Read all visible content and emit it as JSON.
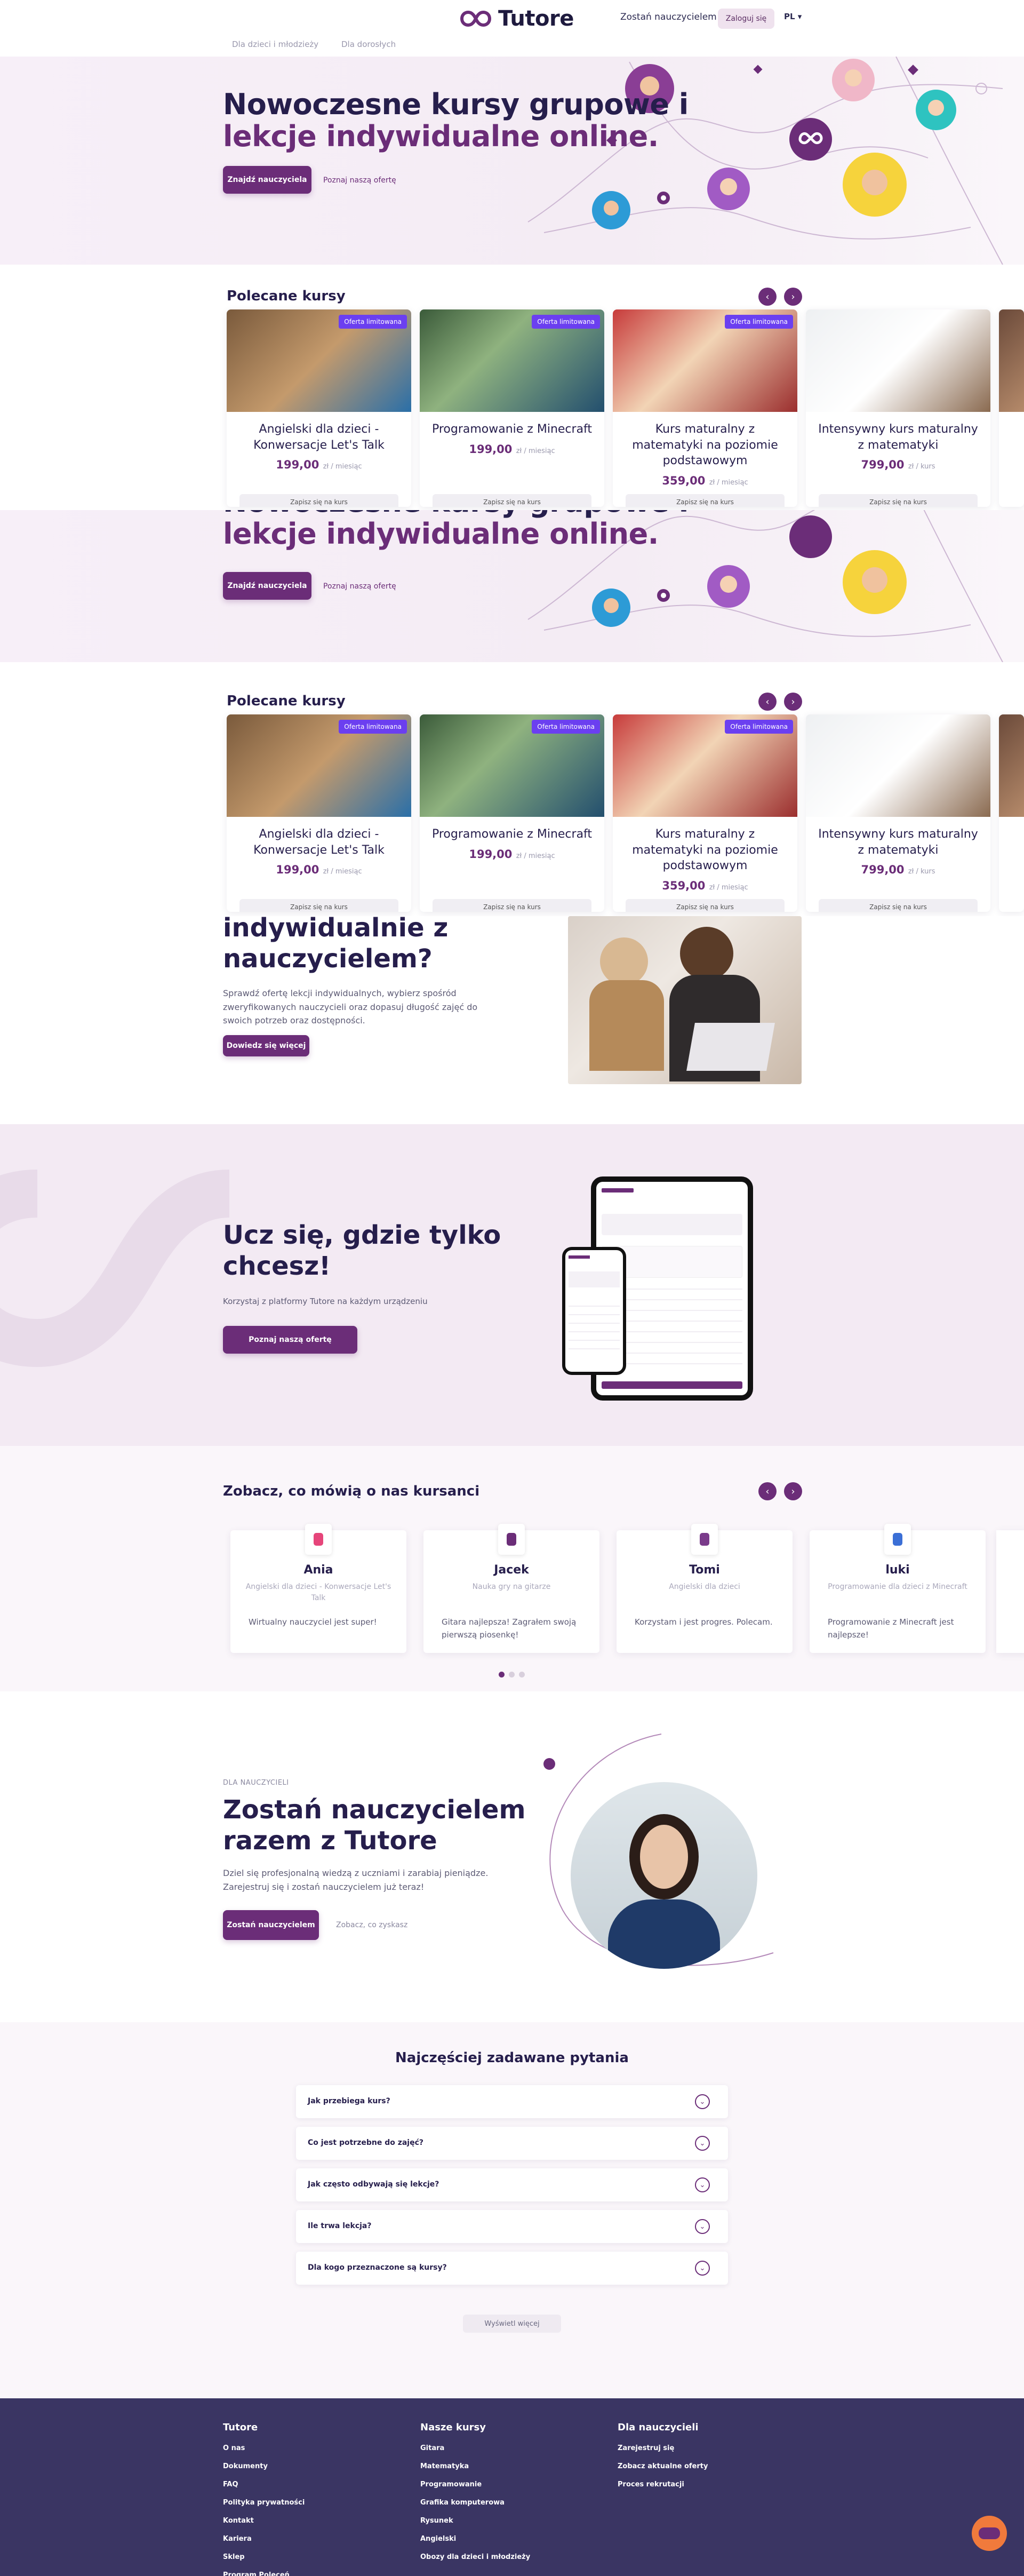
{
  "header": {
    "logo": "Tutore",
    "become_teacher": "Zostań nauczycielem",
    "login": "Zaloguj się",
    "lang": "PL",
    "subnav": [
      "Dla dzieci i młodzieży",
      "Dla dorosłych"
    ]
  },
  "hero": {
    "title_line1": "Nowoczesne kursy grupowe i",
    "title_line2": "lekcje indywidualne online.",
    "btn": "Znajdź nauczyciela",
    "link": "Poznaj naszą ofertę"
  },
  "courses": {
    "heading": "Polecane kursy",
    "badge": "Oferta limitowana",
    "cta": "Zapisz się na kurs",
    "items": [
      {
        "title": "Angielski dla dzieci - Konwersacje Let's Talk",
        "price": "199,00",
        "unit": "zł / miesiąc"
      },
      {
        "title": "Programowanie z Minecraft",
        "price": "199,00",
        "unit": "zł / miesiąc"
      },
      {
        "title": "Kurs maturalny z matematyki na poziomie podstawowym",
        "price": "359,00",
        "unit": "zł / miesiąc"
      },
      {
        "title": "Intensywny kurs maturalny z matematyki",
        "price": "799,00",
        "unit": "zł / kurs"
      }
    ]
  },
  "individual": {
    "title_line1": "indywidualnie z",
    "title_line2": "nauczycielem?",
    "text": "Sprawdź ofertę lekcji indywidualnych, wybierz spośród zweryfikowanych nauczycieli oraz dopasuj długość zajęć do swoich potrzeb oraz dostępności.",
    "btn": "Dowiedz się więcej"
  },
  "devices": {
    "title_line1": "Ucz się, gdzie tylko",
    "title_line2": "chcesz!",
    "text": "Korzystaj z platformy Tutore na każdym urządzeniu",
    "btn": "Poznaj naszą ofertę"
  },
  "testimonials": {
    "heading": "Zobacz, co mówią o nas kursanci",
    "items": [
      {
        "name": "Ania",
        "course": "Angielski dla dzieci - Konwersacje Let's Talk",
        "quote": "Wirtualny nauczyciel jest super!"
      },
      {
        "name": "Jacek",
        "course": "Nauka gry na gitarze",
        "quote": "Gitara najlepsza! Zagrałem swoją pierwszą piosenkę!"
      },
      {
        "name": "Tomi",
        "course": "Angielski dla dzieci",
        "quote": "Korzystam i jest progres. Polecam."
      },
      {
        "name": "luki",
        "course": "Programowanie dla dzieci z Minecraft",
        "quote": "Programowanie z Minecraft jest najlepsze!"
      }
    ]
  },
  "teach": {
    "eyebrow": "DLA NAUCZYCIELI",
    "title_line1": "Zostań nauczycielem",
    "title_line2": "razem z Tutore",
    "text": "Dziel się profesjonalną wiedzą z uczniami i zarabiaj pieniądze. Zarejestruj się i zostań nauczycielem już teraz!",
    "btn": "Zostań nauczycielem",
    "link": "Zobacz, co zyskasz"
  },
  "faq": {
    "heading": "Najczęściej zadawane pytania",
    "items": [
      "Jak przebiega kurs?",
      "Co jest potrzebne do zajęć?",
      "Jak często odbywają się lekcje?",
      "Ile trwa lekcja?",
      "Dla kogo przeznaczone są kursy?"
    ],
    "more": "Wyświetl więcej"
  },
  "footer": {
    "col1": {
      "heading": "Tutore",
      "links": [
        "O nas",
        "Dokumenty",
        "FAQ",
        "Polityka prywatności",
        "Kontakt",
        "Kariera",
        "Sklep",
        "Program Poleceń"
      ]
    },
    "col2": {
      "heading": "Nasze kursy",
      "links": [
        "Gitara",
        "Matematyka",
        "Programowanie",
        "Grafika komputerowa",
        "Rysunek",
        "Angielski",
        "Obozy dla dzieci i młodzieży"
      ]
    },
    "col3": {
      "heading": "Dla nauczycieli",
      "links": [
        "Zarejestruj się",
        "Zobacz aktualne oferty",
        "Proces rekrutacji"
      ]
    }
  },
  "colors": {
    "brand": "#6b2d78",
    "navy": "#261e4c",
    "footer": "#3a3563",
    "badge": "#6b3ff0"
  }
}
